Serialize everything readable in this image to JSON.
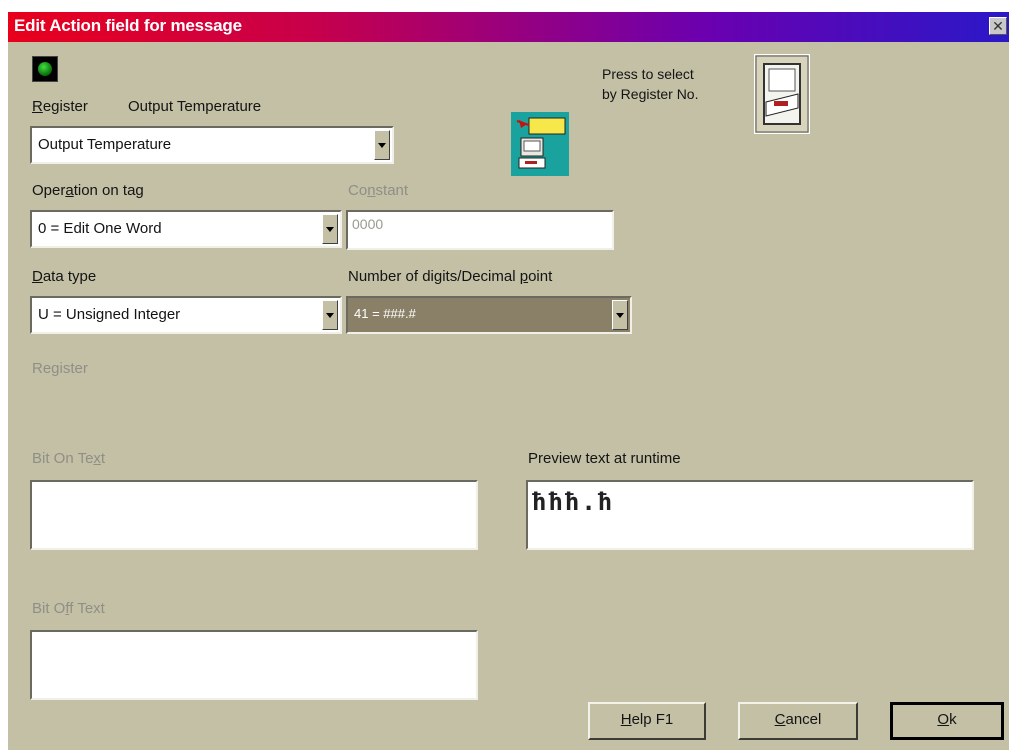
{
  "window": {
    "title": "Edit Action field for message",
    "close_glyph": "✕"
  },
  "register": {
    "label_prefix": "",
    "label_hotkey": "R",
    "label_rest": "egister",
    "current_name": "Output Temperature",
    "selected": "Output Temperature"
  },
  "select_by_register": {
    "line1": "Press to select",
    "line2": "by Register No."
  },
  "operation": {
    "label_before": "Oper",
    "label_hotkey": "a",
    "label_after": "tion on tag",
    "selected": "0 = Edit One Word"
  },
  "constant": {
    "label_before": "Co",
    "label_hotkey": "n",
    "label_after": "stant",
    "value": "0000"
  },
  "data_type": {
    "label_before": "",
    "label_hotkey": "D",
    "label_after": "ata type",
    "selected": "U = Unsigned Integer"
  },
  "digits": {
    "label_before": "Number of digits/Decimal ",
    "label_hotkey": "p",
    "label_after": "oint",
    "selected": "41 = ###.#"
  },
  "register2": {
    "label": "Register"
  },
  "bit_on": {
    "label_before": "Bit On Te",
    "label_hotkey": "x",
    "label_after": "t",
    "value": ""
  },
  "preview": {
    "label": "Preview text at runtime",
    "value": "ħħħ.ħ"
  },
  "bit_off": {
    "label_before": "Bit O",
    "label_hotkey": "f",
    "label_after": "f Text",
    "value": ""
  },
  "buttons": {
    "help_hotkey": "H",
    "help_rest": "elp  F1",
    "cancel_hotkey": "C",
    "cancel_rest": "ancel",
    "ok_hotkey": "O",
    "ok_rest": "k"
  },
  "colors": {
    "dialog_bg": "#c3c0a6",
    "title_gradient_start": "#e8001c",
    "title_gradient_end": "#2a18c8",
    "led_green": "#20c020"
  }
}
